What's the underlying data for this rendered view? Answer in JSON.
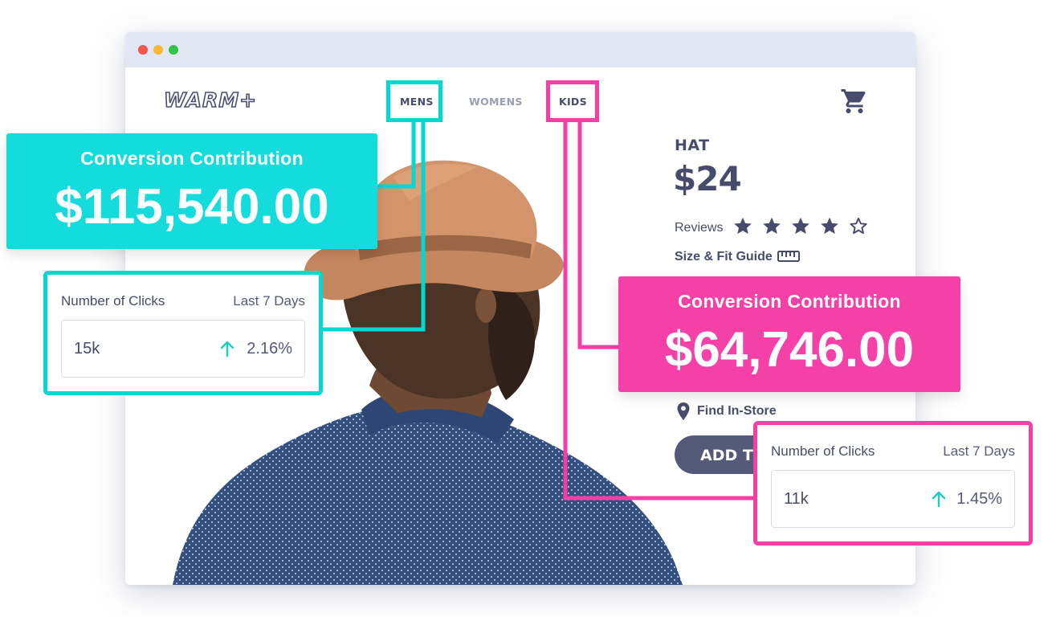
{
  "browser": {
    "logo": "WARM+",
    "nav": {
      "mens": "MENS",
      "womens": "WOMENS",
      "kids": "KIDS"
    },
    "cart_icon": "shopping-cart-icon"
  },
  "product": {
    "name": "HAT",
    "price": "$24",
    "reviews_label": "Reviews",
    "rating": 4,
    "rating_max": 5,
    "size_guide": "Size & Fit Guide",
    "find_store": "Find In-Store",
    "add_button": "ADD TO CART"
  },
  "mens_stats": {
    "conversion_title": "Conversion Contribution",
    "conversion_value": "$115,540.00",
    "clicks_label": "Number of Clicks",
    "range": "Last 7 Days",
    "count": "15k",
    "change": "2.16%"
  },
  "kids_stats": {
    "conversion_title": "Conversion Contribution",
    "conversion_value": "$64,746.00",
    "clicks_label": "Number of Clicks",
    "range": "Last 7 Days",
    "count": "11k",
    "change": "1.45%"
  },
  "colors": {
    "teal": "#00d8d4",
    "pink": "#f43fa6",
    "navy": "#474c6c",
    "titlebar": "#e3e7f4"
  }
}
